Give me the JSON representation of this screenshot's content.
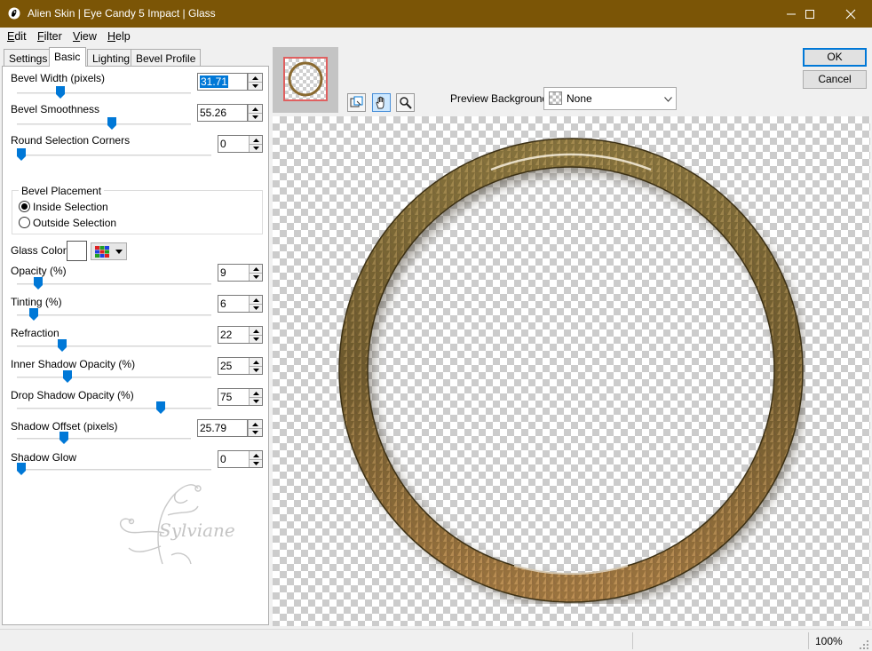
{
  "window": {
    "title": "Alien Skin | Eye Candy 5 Impact | Glass",
    "controls": [
      "minimize-icon",
      "maximize-icon",
      "close-icon"
    ]
  },
  "menu": [
    {
      "label": "Edit",
      "key": "E",
      "rest": "dit"
    },
    {
      "label": "Filter",
      "key": "F",
      "rest": "ilter"
    },
    {
      "label": "View",
      "key": "V",
      "rest": "iew"
    },
    {
      "label": "Help",
      "key": "H",
      "rest": "elp"
    }
  ],
  "tabs": [
    {
      "label": "Settings",
      "active": false
    },
    {
      "label": "Basic",
      "active": true
    },
    {
      "label": "Lighting",
      "active": false
    },
    {
      "label": "Bevel Profile",
      "active": false
    }
  ],
  "params": {
    "bevel_width": {
      "label": "Bevel Width (pixels)",
      "value": "31.71",
      "slider_fraction": 0.25
    },
    "bevel_smoothness": {
      "label": "Bevel Smoothness",
      "value": "55.26",
      "slider_fraction": 0.55
    },
    "round_corners": {
      "label": "Round Selection Corners",
      "value": "0",
      "slider_fraction": 0.0
    },
    "bevel_placement": {
      "title": "Bevel Placement",
      "options": [
        {
          "label": "Inside Selection",
          "selected": true
        },
        {
          "label": "Outside Selection",
          "selected": false
        }
      ]
    },
    "glass_color": {
      "label": "Glass Color",
      "value": "#ffffff"
    },
    "opacity": {
      "label": "Opacity (%)",
      "value": "9",
      "slider_fraction": 0.09
    },
    "tinting": {
      "label": "Tinting (%)",
      "value": "6",
      "slider_fraction": 0.06
    },
    "refraction": {
      "label": "Refraction",
      "value": "22",
      "slider_fraction": 0.22
    },
    "inner_shadow_opacity": {
      "label": "Inner Shadow Opacity (%)",
      "value": "25",
      "slider_fraction": 0.25
    },
    "drop_shadow_opacity": {
      "label": "Drop Shadow Opacity (%)",
      "value": "75",
      "slider_fraction": 0.75
    },
    "shadow_offset": {
      "label": "Shadow Offset (pixels)",
      "value": "25.79",
      "slider_fraction": 0.26
    },
    "shadow_glow": {
      "label": "Shadow Glow",
      "value": "0",
      "slider_fraction": 0.0
    }
  },
  "watermark": "Sylviane",
  "preview_background": {
    "label": "Preview Background:",
    "value": "None"
  },
  "buttons": {
    "ok": "OK",
    "cancel": "Cancel"
  },
  "tools": [
    "navigate-icon",
    "hand-icon",
    "zoom-icon"
  ],
  "status": {
    "zoom": "100%"
  },
  "colors": {
    "titlebar": "#7b5506",
    "accent": "#0078d7",
    "ring_dark": "#5a4a20",
    "ring_light": "#b89050"
  }
}
